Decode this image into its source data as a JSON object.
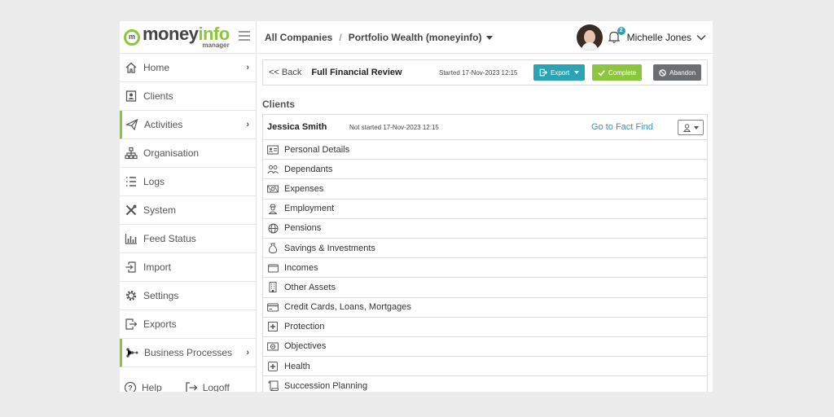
{
  "brand": {
    "name_dark": "money",
    "name_green": "info",
    "subtitle": "manager",
    "mark": "m"
  },
  "sidebar": {
    "items": [
      {
        "label": "Home",
        "icon": "home-icon",
        "chevron": "›"
      },
      {
        "label": "Clients",
        "icon": "clients-icon"
      },
      {
        "label": "Activities",
        "icon": "paper-plane-icon",
        "chevron": "›"
      },
      {
        "label": "Organisation",
        "icon": "org-chart-icon"
      },
      {
        "label": "Logs",
        "icon": "list-icon"
      },
      {
        "label": "System",
        "icon": "tools-icon"
      },
      {
        "label": "Feed Status",
        "icon": "bar-chart-icon"
      },
      {
        "label": "Import",
        "icon": "import-icon"
      },
      {
        "label": "Settings",
        "icon": "gear-icon"
      },
      {
        "label": "Exports",
        "icon": "export-icon"
      },
      {
        "label": "Business Processes",
        "icon": "network-icon",
        "chevron": "›"
      }
    ],
    "footer": {
      "help": "Help",
      "logoff": "Logoff"
    }
  },
  "topbar": {
    "crumb_1": "All Companies",
    "separator": "/",
    "crumb_2": "Portfolio Wealth (moneyinfo)",
    "notification_count": "2",
    "user_name": "Michelle Jones"
  },
  "review": {
    "back": "<< Back",
    "title": "Full Financial Review",
    "started": "Started 17-Nov-2023 12:15",
    "export": "Export",
    "complete": "Complete",
    "abandon": "Abandon"
  },
  "clients": {
    "heading": "Clients",
    "name": "Jessica Smith",
    "status": "Not started 17-Nov-2023 12:15",
    "fact_find": "Go to Fact Find"
  },
  "sections": [
    {
      "label": "Personal Details",
      "icon": "id-card-icon"
    },
    {
      "label": "Dependants",
      "icon": "people-icon"
    },
    {
      "label": "Expenses",
      "icon": "money-icon"
    },
    {
      "label": "Employment",
      "icon": "worker-icon"
    },
    {
      "label": "Pensions",
      "icon": "globe-icon"
    },
    {
      "label": "Savings & Investments",
      "icon": "money-bag-icon"
    },
    {
      "label": "Incomes",
      "icon": "wallet-icon"
    },
    {
      "label": "Other Assets",
      "icon": "building-icon"
    },
    {
      "label": "Credit Cards, Loans, Mortgages",
      "icon": "credit-card-icon"
    },
    {
      "label": "Protection",
      "icon": "shield-icon"
    },
    {
      "label": "Objectives",
      "icon": "target-icon"
    },
    {
      "label": "Health",
      "icon": "medical-icon"
    },
    {
      "label": "Succession Planning",
      "icon": "scroll-icon"
    }
  ],
  "colors": {
    "accent_green": "#8cc63f",
    "teal": "#2aa4b5",
    "link_blue": "#3d8fd1",
    "abandon_grey": "#6b6f73"
  }
}
